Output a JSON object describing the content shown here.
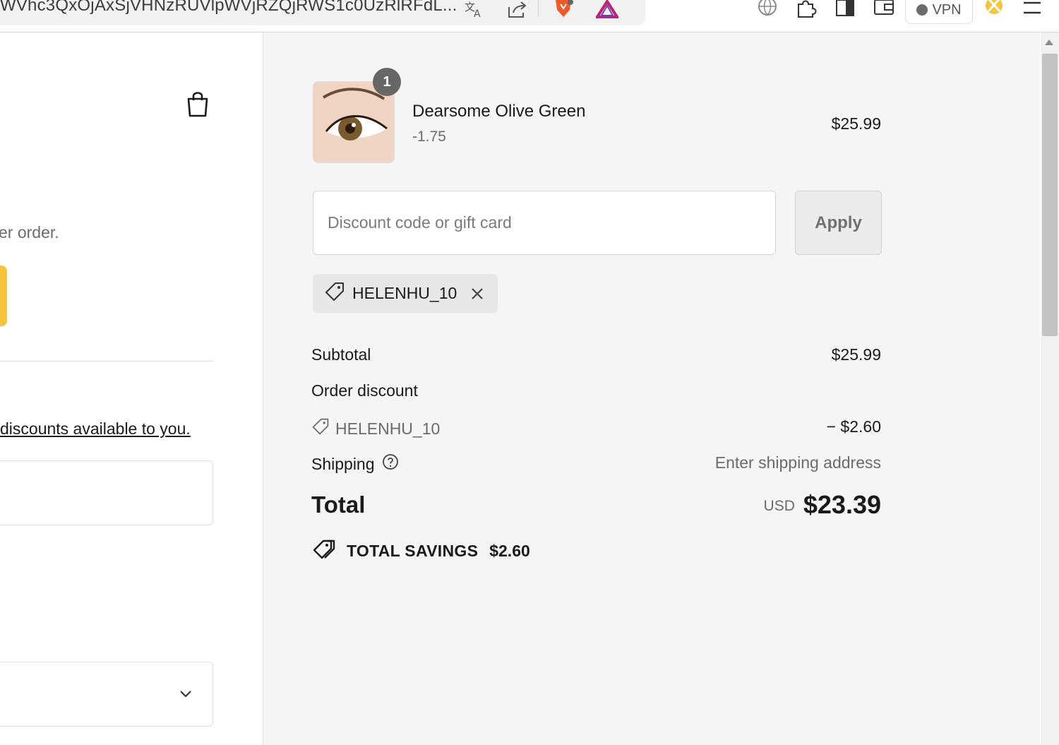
{
  "browser": {
    "url_text": "WVhc3QxOjAxSjVHNzRUVlpWVjRZQjRWS1c0UzRlRFdL...",
    "vpn_label": "VPN",
    "icons": [
      "translate-icon",
      "share-icon",
      "brave-shield-icon",
      "brave-rewards-icon",
      "globe-icon",
      "extensions-icon",
      "sidebar-icon",
      "wallet-icon",
      "leo-ai-icon",
      "menu-icon"
    ]
  },
  "left": {
    "order_text": "er order.",
    "discount_link": "discounts available to you."
  },
  "cart": {
    "item": {
      "quantity": "1",
      "name": "Dearsome Olive Green",
      "variant": "-1.75",
      "price": "$25.99"
    },
    "discount_input": {
      "placeholder": "Discount code or gift card"
    },
    "apply_label": "Apply",
    "applied_code": "HELENHU_10",
    "subtotal_label": "Subtotal",
    "subtotal_value": "$25.99",
    "order_discount_label": "Order discount",
    "discount_code_label": "HELENHU_10",
    "discount_amount": "− $2.60",
    "shipping_label": "Shipping",
    "shipping_value": "Enter shipping address",
    "total_label": "Total",
    "total_currency": "USD",
    "total_amount": "$23.39",
    "savings_label": "TOTAL SAVINGS",
    "savings_amount": "$2.60"
  },
  "colors": {
    "accent_yellow": "#f5c33b",
    "summary_bg": "#f5f5f5",
    "badge_bg": "#666666"
  }
}
